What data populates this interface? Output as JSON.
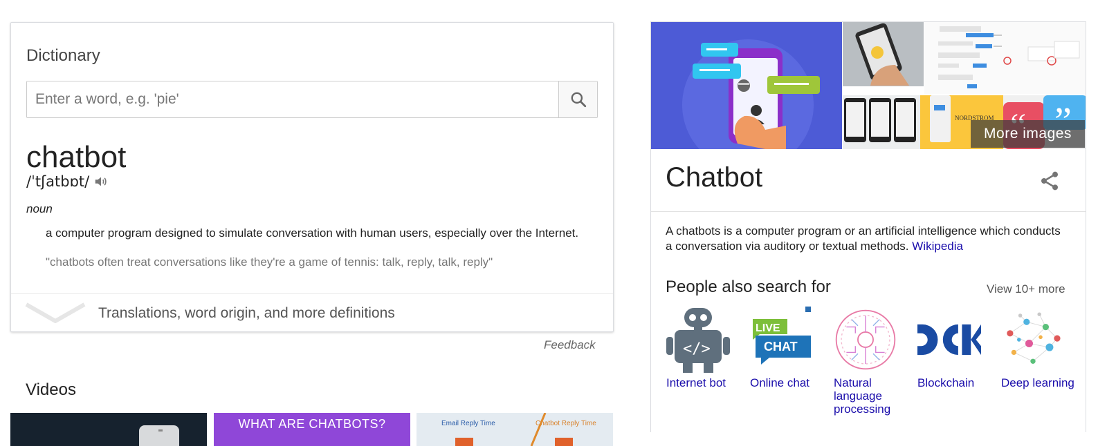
{
  "dictionary": {
    "title": "Dictionary",
    "search_placeholder": "Enter a word, e.g. 'pie'",
    "word": "chatbot",
    "phonetic": "/ˈtʃatbɒt/",
    "part_of_speech": "noun",
    "definition": "a computer program designed to simulate conversation with human users, especially over the Internet.",
    "example": "\"chatbots often treat conversations like they're a game of tennis: talk, reply, talk, reply\"",
    "more_label": "Translations, word origin, and more definitions"
  },
  "feedback_label": "Feedback",
  "videos": {
    "title": "Videos",
    "items": [
      {
        "caption": ""
      },
      {
        "caption": "WHAT ARE CHATBOTS?"
      },
      {
        "caption_left": "Email Reply Time",
        "caption_right": "Chatbot Reply Time"
      }
    ]
  },
  "knowledge_panel": {
    "more_images_label": "More images",
    "nordstrom_label": "NORDSTROM",
    "title": "Chatbot",
    "description": "A chatbots is a computer program or an artificial intelligence which conducts a conversation via auditory or textual methods.",
    "source_link": "Wikipedia",
    "people_also_search_title": "People also search for",
    "view_more_label": "View 10+ more",
    "related": [
      {
        "label": "Internet bot",
        "icon": "robot-icon"
      },
      {
        "label": "Online chat",
        "icon": "live-chat-icon"
      },
      {
        "label": "Natural language processing",
        "icon": "nlp-circuit-icon"
      },
      {
        "label": "Blockchain",
        "icon": "blockchain-logo-icon"
      },
      {
        "label": "Deep learning",
        "icon": "neural-network-icon"
      }
    ]
  },
  "colors": {
    "link": "#1a0dab",
    "main_image_bg": "#4d5bd6",
    "video_purple": "#8f47d8"
  }
}
